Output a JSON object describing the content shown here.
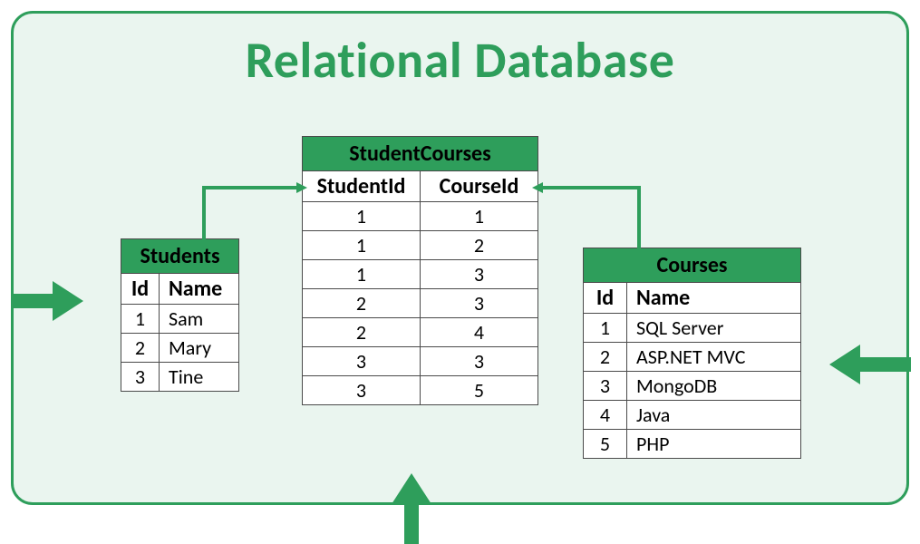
{
  "title": "Relational Database",
  "tables": {
    "students": {
      "name": "Students",
      "columns": [
        "Id",
        "Name"
      ],
      "rows": [
        {
          "id": "1",
          "name": "Sam"
        },
        {
          "id": "2",
          "name": "Mary"
        },
        {
          "id": "3",
          "name": "Tine"
        }
      ]
    },
    "studentcourses": {
      "name": "StudentCourses",
      "columns": [
        "StudentId",
        "CourseId"
      ],
      "rows": [
        {
          "sid": "1",
          "cid": "1"
        },
        {
          "sid": "1",
          "cid": "2"
        },
        {
          "sid": "1",
          "cid": "3"
        },
        {
          "sid": "2",
          "cid": "3"
        },
        {
          "sid": "2",
          "cid": "4"
        },
        {
          "sid": "3",
          "cid": "3"
        },
        {
          "sid": "3",
          "cid": "5"
        }
      ]
    },
    "courses": {
      "name": "Courses",
      "columns": [
        "Id",
        "Name"
      ],
      "rows": [
        {
          "id": "1",
          "name": "SQL Server"
        },
        {
          "id": "2",
          "name": "ASP.NET MVC"
        },
        {
          "id": "3",
          "name": "MongoDB"
        },
        {
          "id": "4",
          "name": "Java"
        },
        {
          "id": "5",
          "name": "PHP"
        }
      ]
    }
  }
}
